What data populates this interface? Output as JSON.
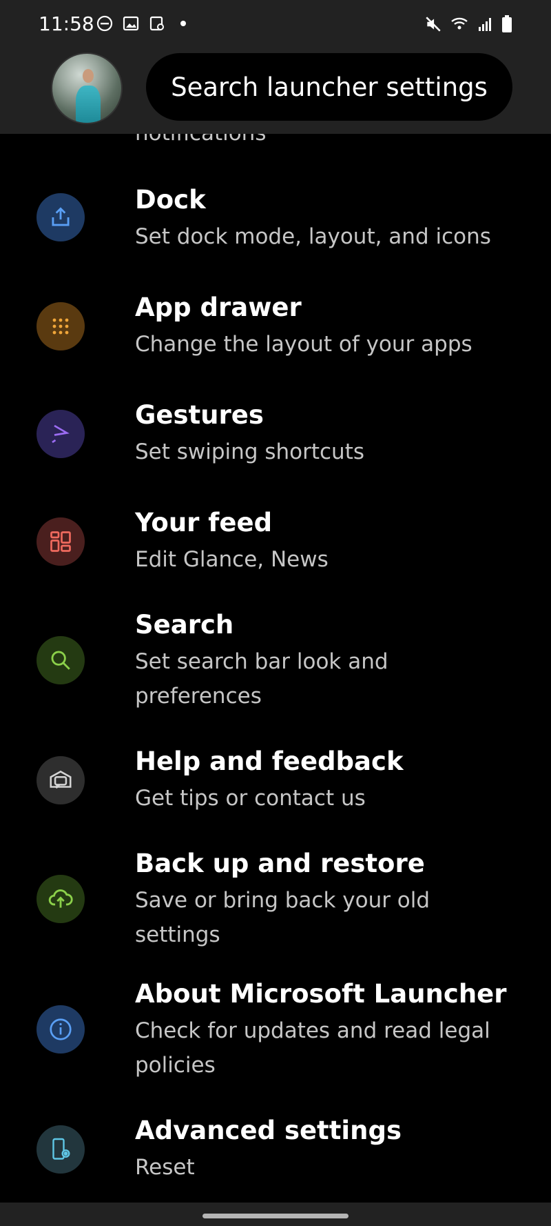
{
  "status_bar": {
    "time": "11:58"
  },
  "header": {
    "search_label": "Search launcher settings"
  },
  "partial_item": "notifications",
  "items": [
    {
      "title": "Dock",
      "subtitle": "Set dock mode, layout, and icons",
      "icon": "dock-icon",
      "color": "#1e3a63"
    },
    {
      "title": "App drawer",
      "subtitle": "Change the layout of your apps",
      "icon": "app-drawer-icon",
      "color": "#5a3a10"
    },
    {
      "title": "Gestures",
      "subtitle": "Set swiping shortcuts",
      "icon": "gestures-icon",
      "color": "#2a2356"
    },
    {
      "title": "Your feed",
      "subtitle": "Edit Glance, News",
      "icon": "feed-icon",
      "color": "#4a1f1e"
    },
    {
      "title": "Search",
      "subtitle": "Set search bar look and preferences",
      "icon": "search-icon",
      "color": "#243a12"
    },
    {
      "title": "Help and feedback",
      "subtitle": "Get tips or contact us",
      "icon": "help-icon",
      "color": "#2e2e2e"
    },
    {
      "title": "Back up and restore",
      "subtitle": "Save or bring back your old settings",
      "icon": "cloud-upload-icon",
      "color": "#243a12"
    },
    {
      "title": "About Microsoft Launcher",
      "subtitle": "Check for updates and read legal policies",
      "icon": "info-icon",
      "color": "#1e3a63"
    },
    {
      "title": "Advanced settings",
      "subtitle": "Reset",
      "icon": "device-settings-icon",
      "color": "#22363d"
    }
  ]
}
